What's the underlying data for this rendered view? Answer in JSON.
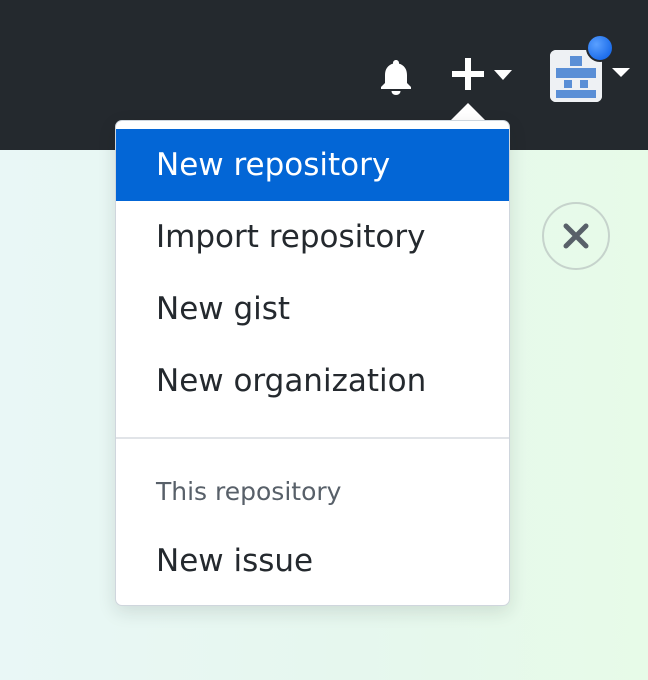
{
  "header": {
    "notifications_icon": "bell-icon",
    "create_icon": "plus-icon",
    "avatar_icon": "identicon",
    "accent_color": "#1f6feb",
    "background_color": "#24292e"
  },
  "dropdown": {
    "items": [
      {
        "label": "New repository",
        "active": true
      },
      {
        "label": "Import repository",
        "active": false
      },
      {
        "label": "New gist",
        "active": false
      },
      {
        "label": "New organization",
        "active": false
      }
    ],
    "section_header": "This repository",
    "section_items": [
      {
        "label": "New issue",
        "active": false
      }
    ],
    "active_color": "#0366d6"
  },
  "banner": {
    "close_icon": "close-icon"
  }
}
